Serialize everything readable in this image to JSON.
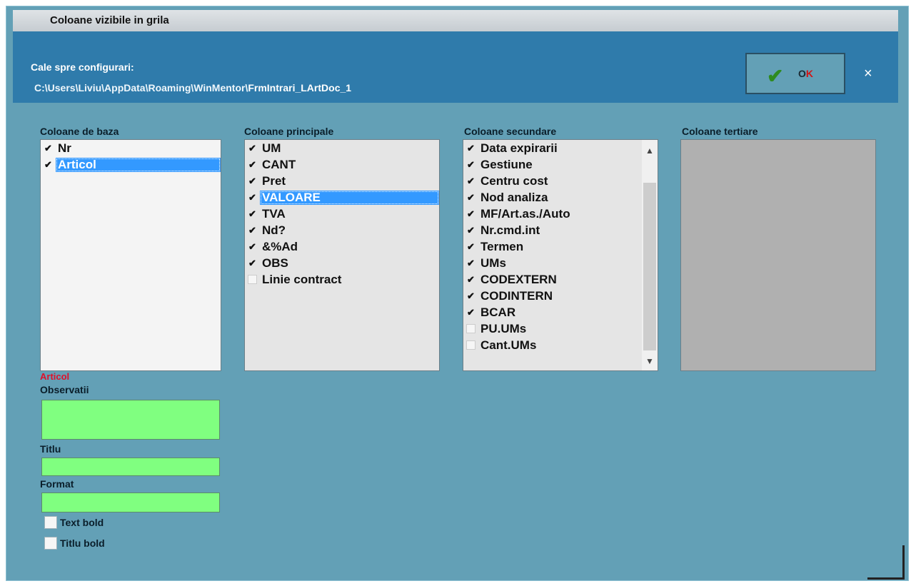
{
  "title": "Coloane vizibile in grila",
  "header": {
    "path_label": "Cale spre configurari:",
    "path_prefix": "C:\\Users\\Liviu\\AppData\\Roaming\\WinMentor\\",
    "path_highlight": "FrmIntrari_LArtDoc_1",
    "ok_label_main": "O",
    "ok_label_accent": "K",
    "close_glyph": "×"
  },
  "columns": {
    "baza": {
      "title": "Coloane de baza",
      "items": [
        {
          "label": "Nr",
          "checked": true
        },
        {
          "label": "Articol",
          "checked": true,
          "selected": true
        }
      ]
    },
    "principale": {
      "title": "Coloane principale",
      "items": [
        {
          "label": "UM",
          "checked": true
        },
        {
          "label": "CANT",
          "checked": true
        },
        {
          "label": "Pret",
          "checked": true
        },
        {
          "label": "VALOARE",
          "checked": true,
          "selected": true
        },
        {
          "label": "TVA",
          "checked": true
        },
        {
          "label": "Nd?",
          "checked": true
        },
        {
          "label": "&%Ad",
          "checked": true
        },
        {
          "label": "OBS",
          "checked": true
        },
        {
          "label": "Linie contract",
          "checked": false
        }
      ]
    },
    "secundare": {
      "title": "Coloane secundare",
      "items": [
        {
          "label": "Data expirarii",
          "checked": true
        },
        {
          "label": "Gestiune",
          "checked": true
        },
        {
          "label": "Centru cost",
          "checked": true
        },
        {
          "label": "Nod analiza",
          "checked": true
        },
        {
          "label": "MF/Art.as./Auto",
          "checked": true
        },
        {
          "label": "Nr.cmd.int",
          "checked": true
        },
        {
          "label": "Termen",
          "checked": true
        },
        {
          "label": "UMs",
          "checked": true
        },
        {
          "label": "CODEXTERN",
          "checked": true
        },
        {
          "label": "CODINTERN",
          "checked": true
        },
        {
          "label": "BCAR",
          "checked": true
        },
        {
          "label": "PU.UMs",
          "checked": false
        },
        {
          "label": "Cant.UMs",
          "checked": false
        }
      ]
    },
    "tertiare": {
      "title": "Coloane tertiare",
      "items": []
    }
  },
  "details": {
    "selected_name": "Articol",
    "observatii_label": "Observatii",
    "observatii_value": "",
    "titlu_label": "Titlu",
    "titlu_value": "",
    "format_label": "Format",
    "format_value": "",
    "text_bold_label": "Text bold",
    "titlu_bold_label": "Titlu bold"
  },
  "colors": {
    "background": "#63a0b6",
    "header": "#2f7bab",
    "selection": "#3399ff",
    "field_green": "#80ff80",
    "accent_red": "#e0102a"
  },
  "icons": {
    "ok": "check-icon",
    "close": "close-icon",
    "checkbox_checked": "✔"
  }
}
